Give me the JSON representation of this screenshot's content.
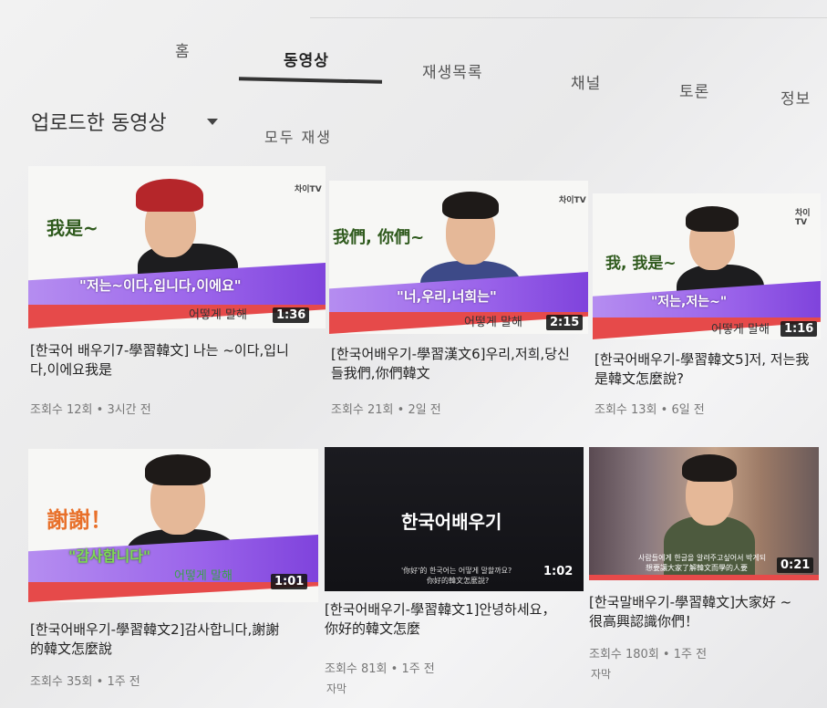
{
  "tabs": [
    {
      "label": "홈"
    },
    {
      "label": "동영상"
    },
    {
      "label": "재생목록"
    },
    {
      "label": "채널"
    },
    {
      "label": "토론"
    },
    {
      "label": "정보"
    }
  ],
  "section": {
    "title": "업로드한 동영상",
    "play_all": "모두 재생"
  },
  "videos": [
    {
      "zh": "我是~",
      "ko": "\"저는~이다,입니다,이에요\"",
      "ko_small": "어떻게 말해",
      "logo": "차이TV",
      "duration": "1:36",
      "title": "[한국어 배우기7-學習韓文] 나는 ~이다,입니다,이에요我是",
      "meta": "조회수 12회 • 3시간 전"
    },
    {
      "zh": "我們, 你們~",
      "ko": "\"너,우리,너희는\"",
      "ko_small": "어떻게 말해",
      "logo": "차이TV",
      "duration": "2:15",
      "title": "[한국어배우기-學習漢文6]우리,저희,당신들我們,你們韓文",
      "meta": "조회수 21회 • 2일 전"
    },
    {
      "zh": "我, 我是~",
      "ko": "\"저는,저는~\"",
      "ko_small": "어떻게 말해",
      "logo": "차이TV",
      "duration": "1:16",
      "title": "[한국어배우기-學習韓文5]저, 저는我是韓文怎麼說?",
      "meta": "조회수 13회 • 6일 전"
    },
    {
      "zh": "謝謝！",
      "ko": "\"감사합니다\"",
      "ko_small": "어떻게 말해",
      "duration": "1:01",
      "title": "[한국어배우기-學習韓文2]감사합니다,謝謝的韓文怎麼說",
      "meta": "조회수 35회 • 1주 전"
    },
    {
      "center": "한국어배우기",
      "caption1": "'你好'的 한국어는 어떻게 말할까요?",
      "caption2": "你好的韓文怎麼說?",
      "duration": "1:02",
      "title": "[한국어배우기-學習韓文1]안녕하세요，你好的韓文怎麼",
      "meta": "조회수 81회 • 1주 전",
      "badge": "자막"
    },
    {
      "caption1": "사람들에게 한글을 알려주고싶어서 박게되",
      "caption2": "想要讓大家了解韓文而學的人要",
      "duration": "0:21",
      "title": "[한국말배우기-學習韓文]大家好 ~ 很高興認識你們！",
      "meta": "조회수 180회 • 1주 전",
      "badge": "자막"
    }
  ]
}
